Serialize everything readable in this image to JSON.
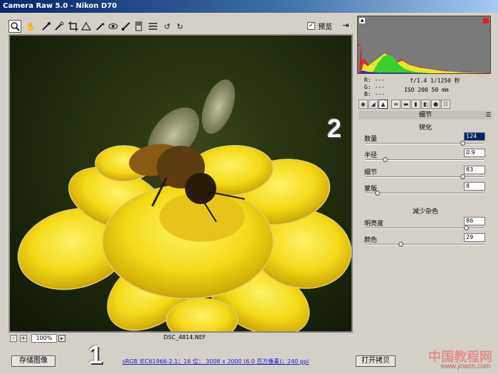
{
  "window": {
    "title": "Camera Raw 5.0 - Nikon D70"
  },
  "toolbar": {
    "tools": [
      "zoom-icon",
      "hand-icon",
      "white-balance-icon",
      "color-sampler-icon",
      "crop-icon",
      "straighten-icon",
      "spot-removal-icon",
      "red-eye-icon",
      "adjustment-brush-icon",
      "graduated-filter-icon",
      "preferences-icon",
      "rotate-left-icon",
      "rotate-right-icon"
    ],
    "preview_label": "预览",
    "preview_checked": "✓"
  },
  "image": {
    "filename": "DSC_4814.NEF"
  },
  "zoom": {
    "minus": "-",
    "plus": "+",
    "level": "100%",
    "menu_arrow": "▸"
  },
  "histogram": {
    "shadow_warning": "▲"
  },
  "readout": {
    "r": "R:  ---",
    "g": "G:  ---",
    "b": "B:  ---",
    "aperture_shutter": "f/1.4  1/1250 秒",
    "iso_focal": "ISO 200   50 mm"
  },
  "panel": {
    "header": "细节",
    "menu_icon": "☰",
    "sharpening": {
      "title": "锐化",
      "amount": {
        "label": "数量",
        "value": "124",
        "fraction": 0.83
      },
      "radius": {
        "label": "半径",
        "value": "0.9",
        "fraction": 0.15
      },
      "detail": {
        "label": "细节",
        "value": "83",
        "fraction": 0.83
      },
      "masking": {
        "label": "蒙版",
        "value": "8",
        "fraction": 0.08
      }
    },
    "noise": {
      "title": "减少杂色",
      "luminance": {
        "label": "明亮度",
        "value": "86",
        "fraction": 0.86
      },
      "color": {
        "label": "颜色",
        "value": "29",
        "fraction": 0.29
      }
    }
  },
  "bottom": {
    "save_label": "存储图像",
    "workflow": "sRGB IEC61966-2.1；16 位； 3008 x 2000 (6.0 百万像素)；240 ppi",
    "open_label": "打开拷贝"
  },
  "annotations": {
    "one": "1",
    "two": "2"
  },
  "watermark": {
    "text": "中国教程网",
    "url": "www.jcwcn.com"
  }
}
